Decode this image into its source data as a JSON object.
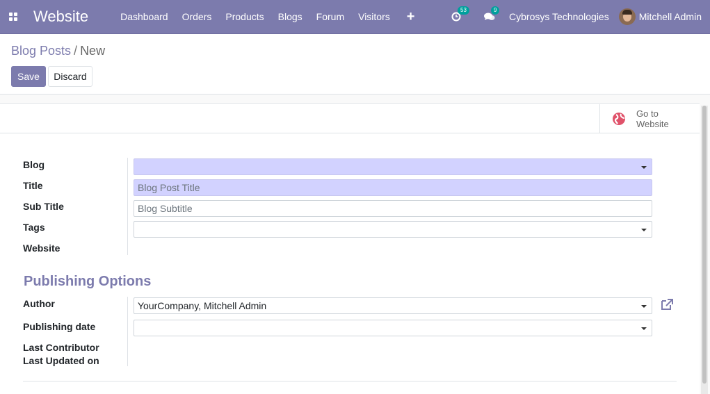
{
  "navbar": {
    "app_name": "Website",
    "menu": [
      "Dashboard",
      "Orders",
      "Products",
      "Blogs",
      "Forum",
      "Visitors"
    ],
    "activity_count": "53",
    "messages_count": "9",
    "company": "Cybrosys Technologies",
    "user": "Mitchell Admin",
    "accent_color": "#7c7bad"
  },
  "breadcrumb": {
    "parent": "Blog Posts",
    "separator": "/",
    "current": "New"
  },
  "buttons": {
    "save": "Save",
    "discard": "Discard"
  },
  "smart_button": {
    "line1": "Go to",
    "line2": "Website",
    "icon": "globe-icon"
  },
  "fields": {
    "blog": {
      "label": "Blog",
      "value": ""
    },
    "title": {
      "label": "Title",
      "placeholder": "Blog Post Title"
    },
    "subtitle": {
      "label": "Sub Title",
      "placeholder": "Blog Subtitle"
    },
    "tags": {
      "label": "Tags",
      "value": ""
    },
    "website": {
      "label": "Website"
    }
  },
  "publishing": {
    "title": "Publishing Options",
    "author": {
      "label": "Author",
      "value": "YourCompany, Mitchell Admin"
    },
    "publishing_date": {
      "label": "Publishing date",
      "value": ""
    },
    "last_contributor": {
      "label": "Last Contributor"
    },
    "last_updated": {
      "label": "Last Updated on"
    }
  }
}
